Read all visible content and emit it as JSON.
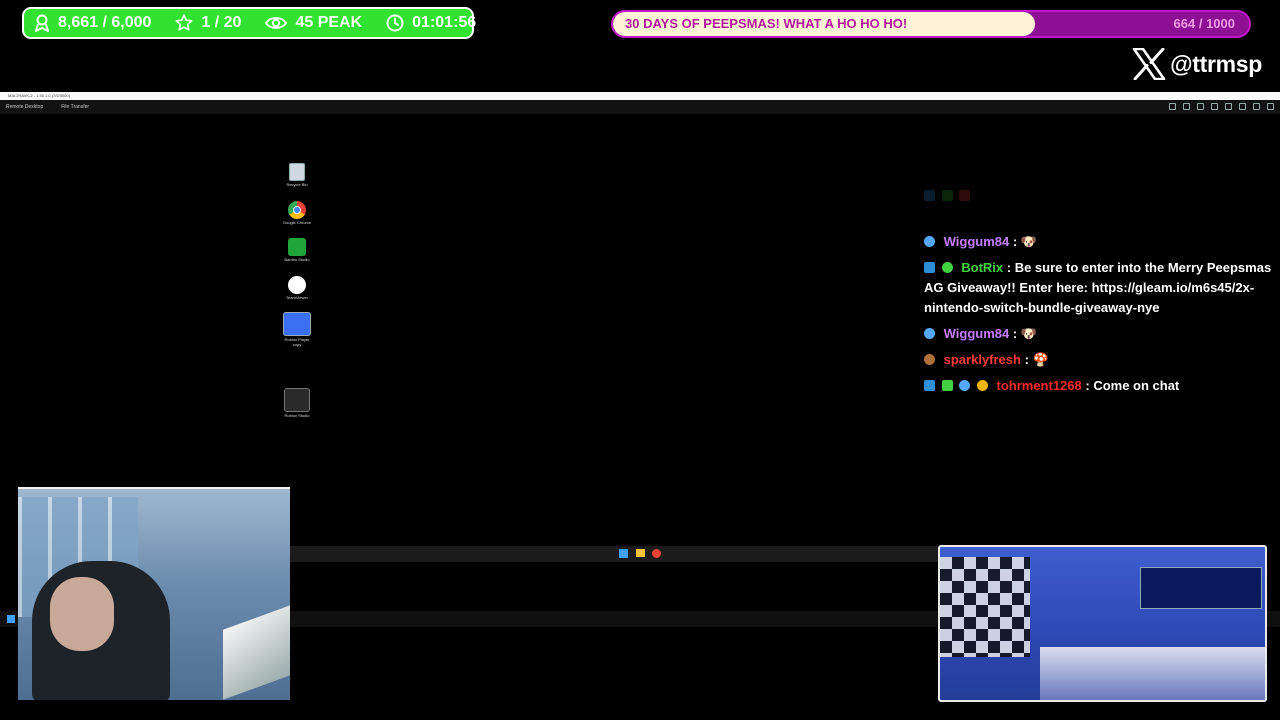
{
  "stats": {
    "followers": "8,661 / 6,000",
    "stars": "1 / 20",
    "peak": "45 PEAK",
    "timer": "01:01:56"
  },
  "goal": {
    "title": "30 DAYS OF PEEPSMAS! WHAT A HO HO HO!",
    "count": "664 / 1000",
    "progress_fraction": 0.664
  },
  "social": {
    "platform_icon": "x-logo-icon",
    "handle": "@ttrmsp"
  },
  "remote_desktop": {
    "title": "MAL2HAVK-2 - 1.50.1.0 (7/5/3000)",
    "menu_items": [
      "Remote Desktop",
      "File Transfer"
    ]
  },
  "desktop_icons": [
    {
      "name": "Recycle Bin",
      "icon": "recycle-bin-icon"
    },
    {
      "name": "Google Chrome",
      "icon": "chrome-icon"
    },
    {
      "name": "Bambu Studio",
      "icon": "bambu-studio-icon"
    },
    {
      "name": "TeamViewer",
      "icon": "teamviewer-icon"
    },
    {
      "name": "Roblox Player copy",
      "icon": "roblox-player-icon"
    },
    {
      "name": "Roblox Studio",
      "icon": "roblox-studio-icon"
    }
  ],
  "chat": [
    {
      "user": "Wiggum84",
      "user_color": "#c77dff",
      "message": "🐶"
    },
    {
      "user": "BotRix",
      "user_color": "#43d143",
      "message": "Be sure to enter into the Merry Peepsmas AG Giveaway!! Enter here: https://gleam.io/m6s45/2x-nintendo-switch-bundle-giveaway-nye"
    },
    {
      "user": "Wiggum84",
      "user_color": "#c77dff",
      "message": "🐶"
    },
    {
      "user": "sparklyfresh",
      "user_color": "#ff3b3b",
      "message": "🍄"
    },
    {
      "user": "tohrment1268",
      "user_color": "#ff2a2a",
      "message": "Come on chat"
    }
  ],
  "colors": {
    "stats_green": "#31e231",
    "goal_purple": "#8d1094",
    "goal_fill": "#fff5d6"
  }
}
